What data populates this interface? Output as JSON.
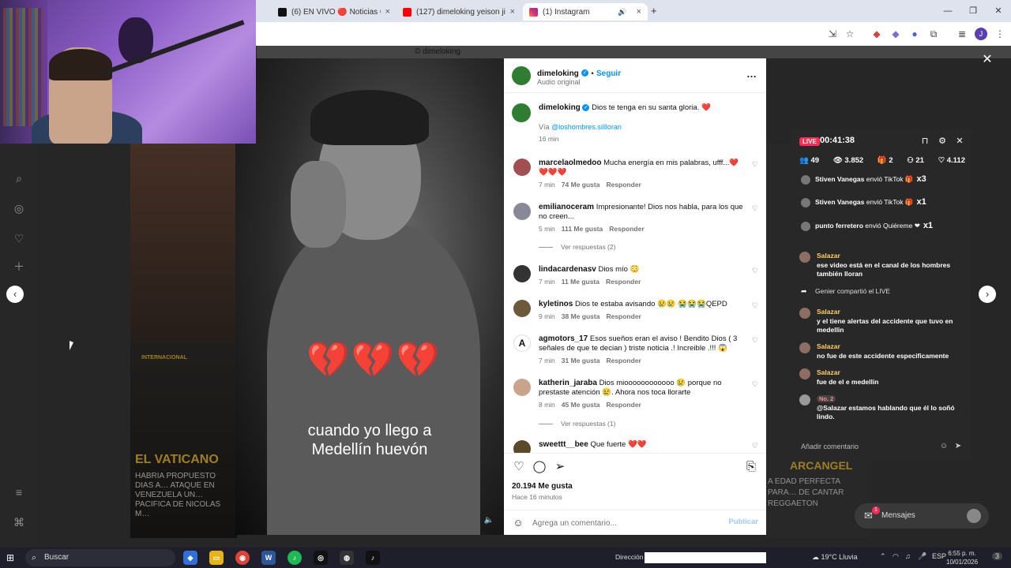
{
  "browser": {
    "tabs": [
      {
        "label": "(6) EN VIVO 🔴 Noticias Carac…"
      },
      {
        "label": "(127) dimeloking yeison jimene…"
      },
      {
        "label": "(1) Instagram"
      }
    ],
    "new_tab": "+"
  },
  "page": {
    "bg_text": "© dimeloking",
    "left_feed": {
      "caption": "EL VATICANO",
      "subtitle": "HABRIA PROPUESTO DIAS A… ATAQUE EN VENEZUELA UN… PACIFICA DE NICOLAS M…",
      "tag": "INTERNACIONAL"
    },
    "right_feed": {
      "caption": "ARCANGEL",
      "subtitle": "A EDAD PERFECTA PARA… DE CANTAR REGGAETON"
    }
  },
  "post": {
    "video": {
      "hearts": "💔💔💔",
      "caption_line1": "cuando yo llego a",
      "caption_line2": "Medellín huevón"
    },
    "header": {
      "username": "dimeloking",
      "dot": "•",
      "follow": "Seguir",
      "audio": "Audio original",
      "more": "…"
    },
    "caption": {
      "username": "dimeloking",
      "text": "Dios te tenga en su santa gloria. ❤️",
      "via_label": "Vía",
      "via_link": "@loshombres.sillloran",
      "time": "16 min"
    },
    "comments": [
      {
        "user": "marcelaolmedoo",
        "text": "Mucha energía en mis palabras, ufff...❤️❤️❤️❤️",
        "time": "7 min",
        "likes": "74 Me gusta",
        "reply": "Responder"
      },
      {
        "user": "emilianoceram",
        "text": "Impresionante! Dios nos habla, para los que no creen...",
        "time": "5 min",
        "likes": "111 Me gusta",
        "reply": "Responder",
        "view_replies": "Ver respuestas (2)"
      },
      {
        "user": "lindacardenasv",
        "text": "Dios mío 😳",
        "time": "7 min",
        "likes": "11 Me gusta",
        "reply": "Responder"
      },
      {
        "user": "kyletinos",
        "text": "Dios te estaba avisando 😢😢 😭😭😭QEPD",
        "time": "9 min",
        "likes": "38 Me gusta",
        "reply": "Responder"
      },
      {
        "user": "agmotors_17",
        "text": "Esos sueños eran el aviso ! Bendito Dios ( 3 señales de que te decian ) triste noticia .! Increible .!!! 😱",
        "time": "7 min",
        "likes": "31 Me gusta",
        "reply": "Responder"
      },
      {
        "user": "katherin_jaraba",
        "text": "Dios mioooooooooooo 😢 porque no prestaste atención 😢. Ahora nos toca llorarte",
        "time": "8 min",
        "likes": "45 Me gusta",
        "reply": "Responder",
        "view_replies": "Ver respuestas (1)"
      },
      {
        "user": "sweettt__bee",
        "text": "Que fuerte ❤️❤️"
      }
    ],
    "likes": "20.194 Me gusta",
    "posted_ago": "Hace 16 minutos",
    "comment_placeholder": "Agrega un comentario...",
    "publish": "Publicar"
  },
  "live": {
    "badge": "LIVE",
    "timer": "00:41:38",
    "stats": [
      "49",
      "3.852",
      "2",
      "21",
      "4.112"
    ],
    "gifts": [
      {
        "user": "Stiven Vanegas",
        "action": "envió TikTok",
        "mult": "x3"
      },
      {
        "user": "Stiven Vanegas",
        "action": "envió TikTok",
        "mult": "x1"
      },
      {
        "user": "punto ferretero",
        "action": "envió Quiéreme",
        "mult": "x1"
      }
    ],
    "messages": [
      {
        "user": "Salazar",
        "text": "ese video está en el canal de los hombres también lloran"
      },
      {
        "user": "Genier",
        "text": "compartió el LIVE"
      },
      {
        "user": "Salazar",
        "text": "y el tiene alertas del accidente que tuvo en medellin"
      },
      {
        "user": "Salazar",
        "text": "no fue de este accidente especificamente"
      },
      {
        "user": "Salazar",
        "text": "fue de el e medellin"
      },
      {
        "user": "No. 2",
        "text": "@Salazar estamos hablando que él lo soñó lindo."
      }
    ],
    "add_comment": "Añadir comentario",
    "messages_label": "Mensajes",
    "messages_count": "1"
  },
  "taskbar": {
    "search": "Buscar",
    "address_label": "Dirección",
    "weather": "19°C  Lluvia",
    "lang": "ESP",
    "time": "6:55 p. m.",
    "date": "10/01/2026",
    "notif": "3"
  }
}
